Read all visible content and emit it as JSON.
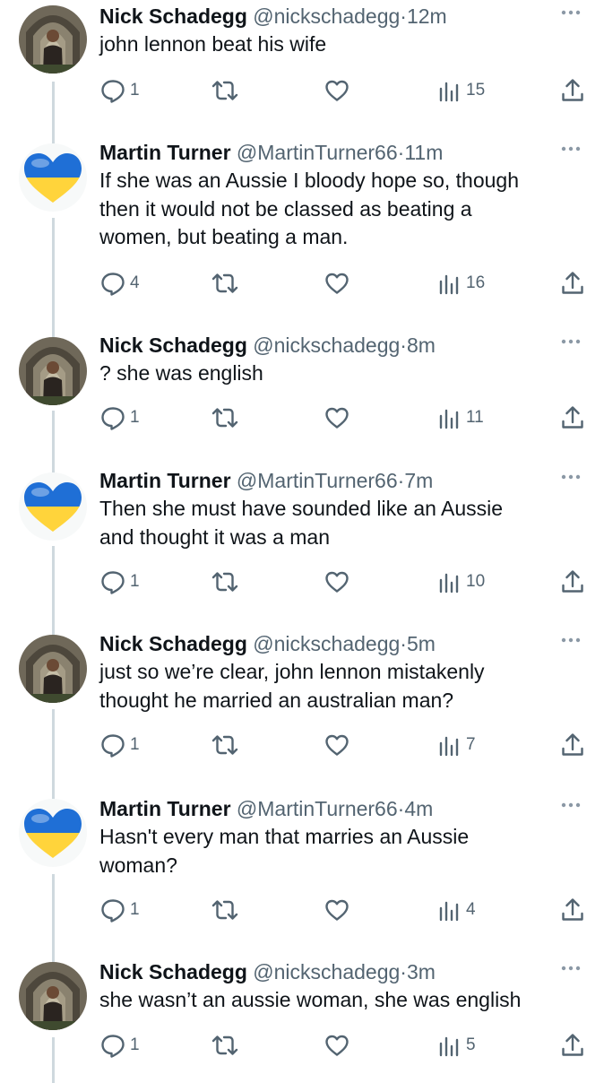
{
  "tweets": [
    {
      "name": "Nick Schadegg",
      "handle": "@nickschadegg",
      "dot": "·",
      "time": "12m",
      "avatar": "avatar-nick",
      "lines": [
        "john lennon beat his wife"
      ],
      "replies": "1",
      "views": "15"
    },
    {
      "name": "Martin Turner",
      "handle": "@MartinTurner66",
      "dot": "·",
      "time": "11m",
      "avatar": "avatar-ukraine-heart",
      "lines": [
        "If she was an Aussie I bloody hope so, though",
        "then it would not be classed as beating a",
        "women, but beating a man."
      ],
      "replies": "4",
      "views": "16"
    },
    {
      "name": "Nick Schadegg",
      "handle": "@nickschadegg",
      "dot": "·",
      "time": "8m",
      "avatar": "avatar-nick",
      "lines": [
        "? she was english"
      ],
      "replies": "1",
      "views": "11"
    },
    {
      "name": "Martin Turner",
      "handle": "@MartinTurner66",
      "dot": "·",
      "time": "7m",
      "avatar": "avatar-ukraine-heart",
      "lines": [
        "Then she must have sounded like an Aussie",
        "and thought it was a man"
      ],
      "replies": "1",
      "views": "10"
    },
    {
      "name": "Nick Schadegg",
      "handle": "@nickschadegg",
      "dot": "·",
      "time": "5m",
      "avatar": "avatar-nick",
      "lines": [
        "just so we’re clear, john lennon mistakenly",
        "thought he married an australian man?"
      ],
      "replies": "1",
      "views": "7"
    },
    {
      "name": "Martin Turner",
      "handle": "@MartinTurner66",
      "dot": "·",
      "time": "4m",
      "avatar": "avatar-ukraine-heart",
      "lines": [
        "Hasn't every man that marries an Aussie",
        "woman?"
      ],
      "replies": "1",
      "views": "4"
    },
    {
      "name": "Nick Schadegg",
      "handle": "@nickschadegg",
      "dot": "·",
      "time": "3m",
      "avatar": "avatar-nick",
      "lines": [
        "she wasn’t an aussie woman, she was english"
      ],
      "replies": "1",
      "views": "5"
    }
  ],
  "icons": {
    "reply": "reply-icon",
    "retweet": "retweet-icon",
    "like": "like-icon",
    "views": "views-icon",
    "share": "share-icon",
    "more": "more-icon"
  },
  "colors": {
    "text": "#0f1419",
    "secondary": "#536471",
    "thread_line": "#cfd9de",
    "ukraine_blue": "#1f6fd6",
    "ukraine_yellow": "#ffd43b"
  }
}
